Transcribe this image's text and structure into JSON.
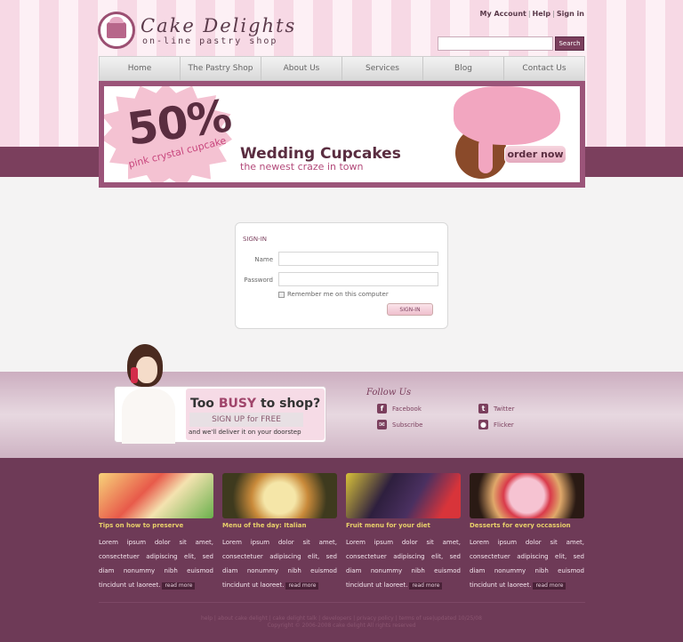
{
  "site": {
    "logo_title": "Cake Delights",
    "logo_subtitle": "on-line pastry shop"
  },
  "top_links": {
    "account": "My Account",
    "help": "Help",
    "signin": "Sign in"
  },
  "search": {
    "value": "",
    "button": "Search"
  },
  "nav": [
    "Home",
    "The Pastry Shop",
    "About Us",
    "Services",
    "Blog",
    "Contact Us"
  ],
  "banner": {
    "percent": "50%",
    "percent_sub": "pink crystal cupcake",
    "title": "Wedding Cupcakes",
    "subtitle": "the newest craze in town",
    "order_button": "order now"
  },
  "signin": {
    "title": "SIGN-IN",
    "name_label": "Name",
    "password_label": "Password",
    "remember_label": "Remember me on this computer",
    "button": "SIGN-IN"
  },
  "promo": {
    "busy_prefix": "Too ",
    "busy_word": "BUSY",
    "busy_suffix": " to shop?",
    "signup": "SIGN UP for FREE",
    "doorstep": "and we'll deliver it on your doorstep"
  },
  "follow": {
    "title": "Follow Us",
    "items": [
      {
        "label": "Facebook",
        "icon": "facebook-icon"
      },
      {
        "label": "Twitter",
        "icon": "twitter-icon"
      },
      {
        "label": "Subscribe",
        "icon": "mail-icon"
      },
      {
        "label": "Flicker",
        "icon": "flickr-icon"
      }
    ]
  },
  "columns": [
    {
      "title": "Tips on how to preserve",
      "text": "Lorem ipsum dolor sit amet, consectetuer adipiscing elit, sed diam nonummy nibh euismod tincidunt ut laoreet.",
      "more": "read more"
    },
    {
      "title": "Menu of the day: Italian",
      "text": "Lorem ipsum dolor sit amet, consectetuer adipiscing elit, sed diam nonummy nibh euismod tincidunt ut laoreet.",
      "more": "read more"
    },
    {
      "title": "Fruit menu for your diet",
      "text": "Lorem ipsum dolor sit amet, consectetuer adipiscing elit, sed diam nonummy nibh euismod tincidunt ut laoreet.",
      "more": "read more"
    },
    {
      "title": "Desserts for every occassion",
      "text": "Lorem ipsum dolor sit amet, consectetuer adipiscing elit, sed diam nonummy nibh euismod tincidunt ut laoreet.",
      "more": "read more"
    }
  ],
  "footer": {
    "links": "help | about cake delight | cake delight talk | developers | privacy policy | terms of use|updated 10/25/08",
    "copyright": "Copyright © 2006-2008 cake delight All rights reserved"
  },
  "colors": {
    "plum": "#7b3f5d",
    "footer": "#6e3a57",
    "accent_pink": "#f2a6c0",
    "gold": "#e8d06a"
  }
}
